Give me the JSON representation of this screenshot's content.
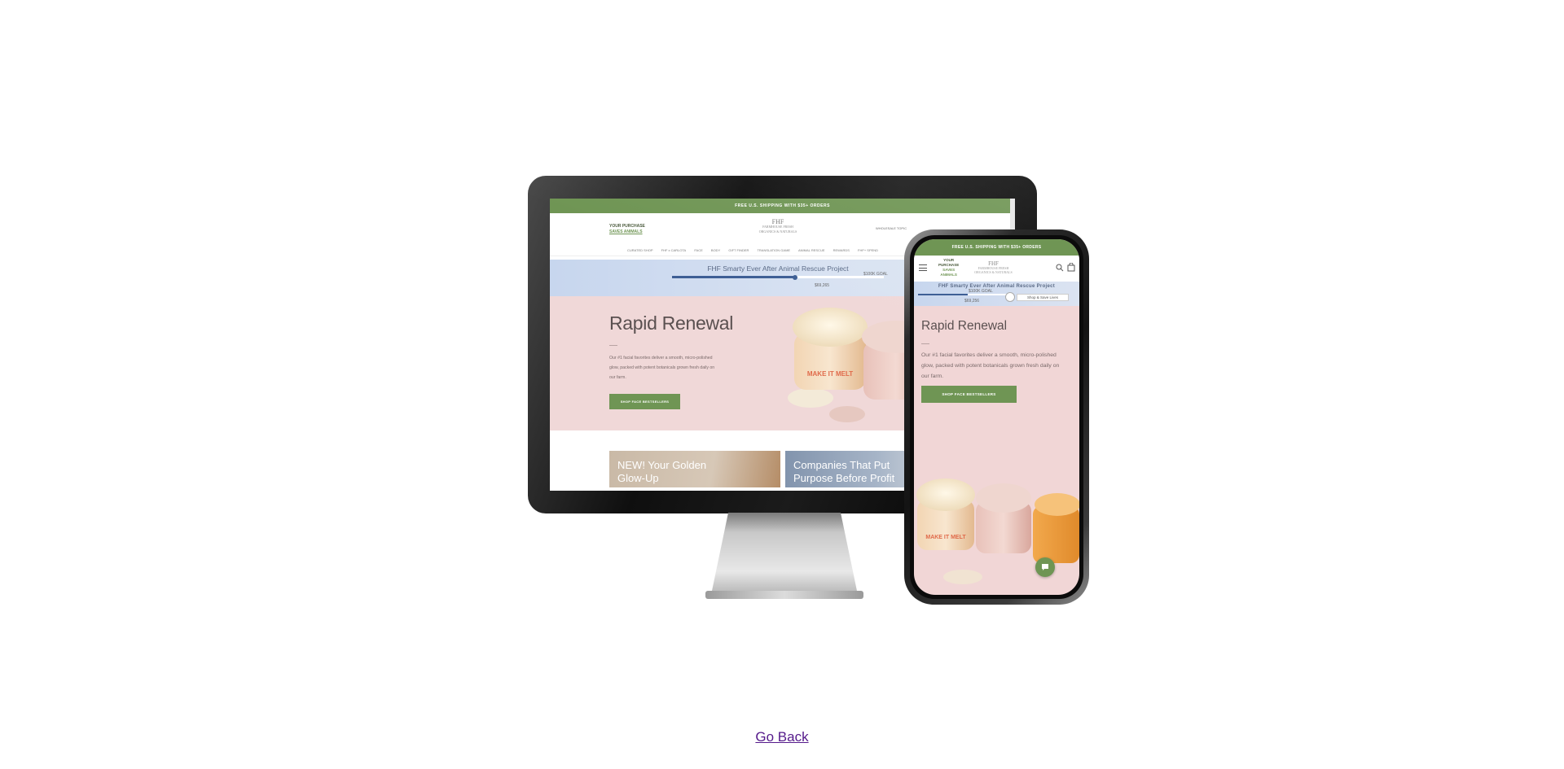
{
  "desktop": {
    "shipping_banner": "FREE U.S. SHIPPING WITH $35+ ORDERS",
    "promo_line1": "YOUR PURCHASE",
    "promo_line2": "SAVES ANIMALS",
    "logo_mark": "FHF",
    "logo_line1": "FARMHOUSE FRESH",
    "logo_line2": "ORGANICS & NATURALS",
    "util_link": "WHOLESALE TOPIC",
    "nav_items": [
      "CURATED SHOP",
      "FHF x CARLOTA",
      "FACE",
      "BODY",
      "GIFT FINDER",
      "TRANSLATION GAME",
      "ANIMAL RESCUE",
      "REWARDS",
      "FHF+ SPEND"
    ],
    "donation": {
      "title": "FHF Smarty Ever After Animal Rescue Project",
      "goal": "$100K GOAL",
      "raised": "$69,265",
      "progress": 0.58
    },
    "hero": {
      "title": "Rapid Renewal",
      "description": "Our #1 facial favorites deliver a smooth, micro-polished glow, packed with potent botanicals grown fresh daily on our farm.",
      "button": "SHOP FACE BESTSELLERS",
      "jar_label": "MAKE IT MELT"
    },
    "tiles": [
      {
        "text": "NEW! Your Golden Glow-Up"
      },
      {
        "text": "Companies That Put Purpose Before Profit"
      }
    ]
  },
  "mobile": {
    "shipping_banner": "FREE U.S. SHIPPING WITH $35+ ORDERS",
    "promo": [
      "YOUR",
      "PURCHASE",
      "SAVES",
      "ANIMALS"
    ],
    "logo_mark": "FHF",
    "logo_line1": "FARMHOUSE FRESH",
    "logo_line2": "ORGANICS & NATURALS",
    "donation": {
      "title": "FHF Smarty Ever After Animal Rescue Project",
      "goal": "$100K GOAL",
      "raised": "$69,256",
      "progress": 0.55,
      "chip": "Shop & Save Lives"
    },
    "hero": {
      "title": "Rapid Renewal",
      "description": "Our #1 facial favorites deliver a smooth, micro-polished glow, packed with potent botanicals grown fresh daily on our farm.",
      "button": "SHOP FACE BESTSELLERS",
      "jar_label": "MAKE IT MELT"
    }
  },
  "go_back": "Go Back",
  "colors": {
    "brand_green": "#6f9554",
    "hero_pink": "#f0d8d8",
    "donation_blue": "#c7d6ee",
    "progress_blue": "#3e5f95"
  }
}
